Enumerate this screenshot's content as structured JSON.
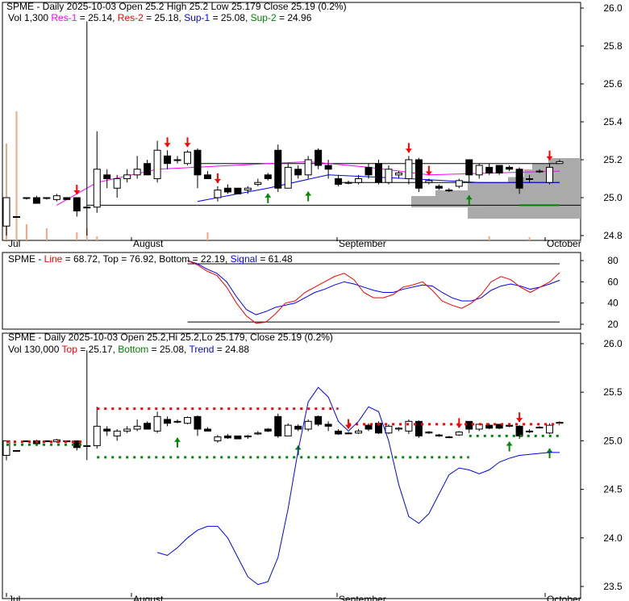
{
  "chart_data": {
    "type": "candlestick",
    "symbol": "SPME",
    "panel1": {
      "title_parts": [
        "SPME - Daily 2025-10-03 Open 25.2  High 25.2  Low 25.179  Close 25.19 (0.2%)"
      ],
      "vol_text": "Vol 1,300",
      "res1_label": "Res-1",
      "res1_value": " = 25.14,",
      "res2_label": "Res-2",
      "res2_value": " = 25.18,",
      "sup1_label": "Sup-1",
      "sup1_value": " = 25.08,",
      "sup2_label": "Sup-2",
      "sup2_value": " = 24.96",
      "yticks": [
        "26.0",
        "25.8",
        "25.6",
        "25.4",
        "25.2",
        "25.0",
        "24.8"
      ],
      "ylim": [
        24.8,
        26.0
      ]
    },
    "panel2": {
      "prefix": "SPME - ",
      "line_label": "Line",
      "line_value": " = 68.72, Top = 76.92, Bottom = 22.19, ",
      "signal_label": "Signal",
      "signal_value": " = 61.48",
      "yticks": [
        "80",
        "60",
        "40",
        "20"
      ],
      "ylim": [
        20,
        80
      ],
      "top": 76.92,
      "bottom": 22.19,
      "line_start": 18,
      "line": [
        80,
        76,
        70,
        66,
        55,
        40,
        28,
        21,
        22,
        30,
        40,
        42,
        50,
        55,
        60,
        65,
        68,
        62,
        50,
        45,
        45,
        48,
        55,
        57,
        60,
        52,
        42,
        38,
        35,
        40,
        48,
        60,
        65,
        62,
        55,
        50,
        55,
        60,
        68.72
      ],
      "signal": [
        80,
        77,
        72,
        68,
        60,
        46,
        34,
        29,
        32,
        36,
        38,
        40,
        45,
        50,
        53,
        57,
        60,
        58,
        55,
        52,
        50,
        50,
        53,
        55,
        57,
        56,
        50,
        45,
        42,
        42,
        45,
        52,
        56,
        58,
        56,
        53,
        55,
        58,
        61.48
      ]
    },
    "panel3": {
      "title": "SPME - Daily 2025-10-03 Open 25.2,Hi 25.2,Lo 25.179, Close 25.19 (0.2%)",
      "vol_text": "Vol 130,000",
      "top_label": "Top",
      "top_value": " = 25.17,",
      "bottom_label": "Bottom",
      "bottom_value": " = 25.08,",
      "trend_label": "Trend",
      "trend_value": " = 24.88",
      "yticks": [
        "26.0",
        "25.5",
        "25.0",
        "24.5",
        "24.0",
        "23.5"
      ],
      "ylim": [
        23.5,
        26.0
      ],
      "trend_start": 15,
      "trend": [
        23.85,
        23.82,
        23.9,
        24.0,
        24.08,
        24.12,
        24.12,
        24.0,
        23.8,
        23.6,
        23.52,
        23.55,
        23.8,
        24.3,
        24.9,
        25.4,
        25.55,
        25.45,
        25.2,
        25.1,
        25.2,
        25.35,
        25.3,
        25.0,
        24.55,
        24.22,
        24.15,
        24.25,
        24.45,
        24.65,
        24.72,
        24.7,
        24.66,
        24.7,
        24.78,
        24.82,
        24.85,
        24.86,
        24.87,
        24.88,
        24.88
      ]
    },
    "xlabels": [
      "Jul",
      "August",
      "September",
      "October"
    ],
    "ohlc": [
      [
        24.85,
        25.0,
        24.8,
        25.0
      ],
      [
        24.9,
        24.9,
        24.9,
        24.9
      ],
      [
        25.0,
        25.0,
        24.99,
        25.0
      ],
      [
        25.0,
        25.01,
        24.97,
        24.97
      ],
      [
        25.0,
        25.0,
        24.99,
        25.0
      ],
      [
        24.99,
        25.02,
        24.98,
        25.01
      ],
      [
        25.0,
        25.0,
        24.99,
        24.99
      ],
      [
        25.0,
        25.0,
        24.9,
        24.93
      ],
      [
        24.95,
        25.93,
        24.8,
        24.95
      ],
      [
        24.95,
        25.35,
        24.92,
        25.15
      ],
      [
        25.12,
        25.15,
        25.05,
        25.1
      ],
      [
        25.05,
        25.12,
        25.0,
        25.1
      ],
      [
        25.1,
        25.15,
        25.08,
        25.12
      ],
      [
        25.12,
        25.22,
        25.1,
        25.15
      ],
      [
        25.18,
        25.2,
        25.12,
        25.12
      ],
      [
        25.1,
        25.3,
        25.08,
        25.25
      ],
      [
        25.22,
        25.25,
        25.15,
        25.18
      ],
      [
        25.2,
        25.22,
        25.18,
        25.2
      ],
      [
        25.18,
        25.25,
        25.17,
        25.24
      ],
      [
        25.25,
        25.26,
        25.05,
        25.12
      ],
      [
        25.12,
        25.14,
        25.1,
        25.1
      ],
      [
        25.0,
        25.06,
        24.98,
        25.04
      ],
      [
        25.05,
        25.07,
        25.02,
        25.03
      ],
      [
        25.05,
        25.05,
        25.02,
        25.02
      ],
      [
        25.04,
        25.06,
        25.02,
        25.05
      ],
      [
        25.07,
        25.1,
        25.06,
        25.08
      ],
      [
        25.12,
        25.13,
        25.09,
        25.1
      ],
      [
        25.25,
        25.28,
        25.03,
        25.05
      ],
      [
        25.05,
        25.18,
        25.05,
        25.16
      ],
      [
        25.15,
        25.17,
        25.1,
        25.12
      ],
      [
        25.12,
        25.22,
        25.1,
        25.2
      ],
      [
        25.25,
        25.26,
        25.15,
        25.17
      ],
      [
        25.17,
        25.2,
        25.1,
        25.15
      ],
      [
        25.1,
        25.12,
        25.06,
        25.07
      ],
      [
        25.08,
        25.09,
        25.07,
        25.08
      ],
      [
        25.08,
        25.12,
        25.07,
        25.1
      ],
      [
        25.16,
        25.18,
        25.1,
        25.12
      ],
      [
        25.18,
        25.2,
        25.07,
        25.08
      ],
      [
        25.08,
        25.17,
        25.07,
        25.15
      ],
      [
        25.12,
        25.14,
        25.1,
        25.13
      ],
      [
        25.1,
        25.22,
        25.07,
        25.2
      ],
      [
        25.2,
        25.21,
        25.03,
        25.05
      ],
      [
        25.08,
        25.1,
        25.07,
        25.09
      ],
      [
        25.06,
        25.07,
        25.04,
        25.05
      ],
      [
        25.04,
        25.05,
        25.03,
        25.04
      ],
      [
        25.06,
        25.1,
        25.05,
        25.09
      ],
      [
        25.2,
        25.2,
        25.08,
        25.12
      ],
      [
        25.12,
        25.18,
        25.1,
        25.17
      ],
      [
        25.16,
        25.18,
        25.12,
        25.13
      ],
      [
        25.17,
        25.17,
        25.12,
        25.13
      ],
      [
        25.16,
        25.17,
        25.14,
        25.15
      ],
      [
        25.15,
        25.16,
        25.02,
        25.05
      ],
      [
        25.1,
        25.12,
        25.08,
        25.1
      ],
      [
        25.14,
        25.15,
        25.13,
        25.14
      ],
      [
        25.08,
        25.18,
        25.07,
        25.16
      ],
      [
        25.18,
        25.2,
        25.18,
        25.19
      ]
    ],
    "down_arrows": [
      7,
      16,
      18,
      21,
      40,
      42,
      54
    ],
    "up_arrows": [
      26,
      30,
      46
    ],
    "colors": {
      "up": "#ffffff",
      "down": "#000000",
      "res1": "#ff00ff",
      "res2": "#ff0000",
      "sup1": "#0000ff",
      "sup2": "#008000",
      "volume": "#f4a582"
    }
  }
}
